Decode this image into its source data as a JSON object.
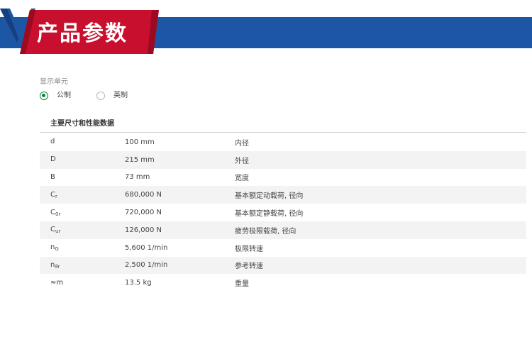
{
  "header": {
    "title": "产品参数",
    "colors": {
      "bar": "#1e56a6",
      "tab": "#c8102e",
      "mark": "#1e56a6"
    }
  },
  "units": {
    "label": "显示单元",
    "options": [
      {
        "label": "公制",
        "checked": true
      },
      {
        "label": "英制",
        "checked": false
      }
    ],
    "accent": "#00893d"
  },
  "table": {
    "title": "主要尺寸和性能数据",
    "rows": [
      {
        "symbol": "d",
        "sub": "",
        "value": "100 mm",
        "desc": "内径"
      },
      {
        "symbol": "D",
        "sub": "",
        "value": "215 mm",
        "desc": "外径"
      },
      {
        "symbol": "B",
        "sub": "",
        "value": "73 mm",
        "desc": "宽度"
      },
      {
        "symbol": "C",
        "sub": "r",
        "value": "680,000 N",
        "desc": "基本额定动载荷, 径向"
      },
      {
        "symbol": "C",
        "sub": "0r",
        "value": "720,000 N",
        "desc": "基本额定静载荷, 径向"
      },
      {
        "symbol": "C",
        "sub": "ur",
        "value": "126,000 N",
        "desc": "疲劳极限载荷, 径向"
      },
      {
        "symbol": "n",
        "sub": "G",
        "value": "5,600 1/min",
        "desc": "极限转速"
      },
      {
        "symbol": "n",
        "sub": "ϑr",
        "value": "2,500 1/min",
        "desc": "参考转速"
      },
      {
        "symbol": "≈m",
        "sub": "",
        "value": "13.5 kg",
        "desc": "重量"
      }
    ]
  }
}
